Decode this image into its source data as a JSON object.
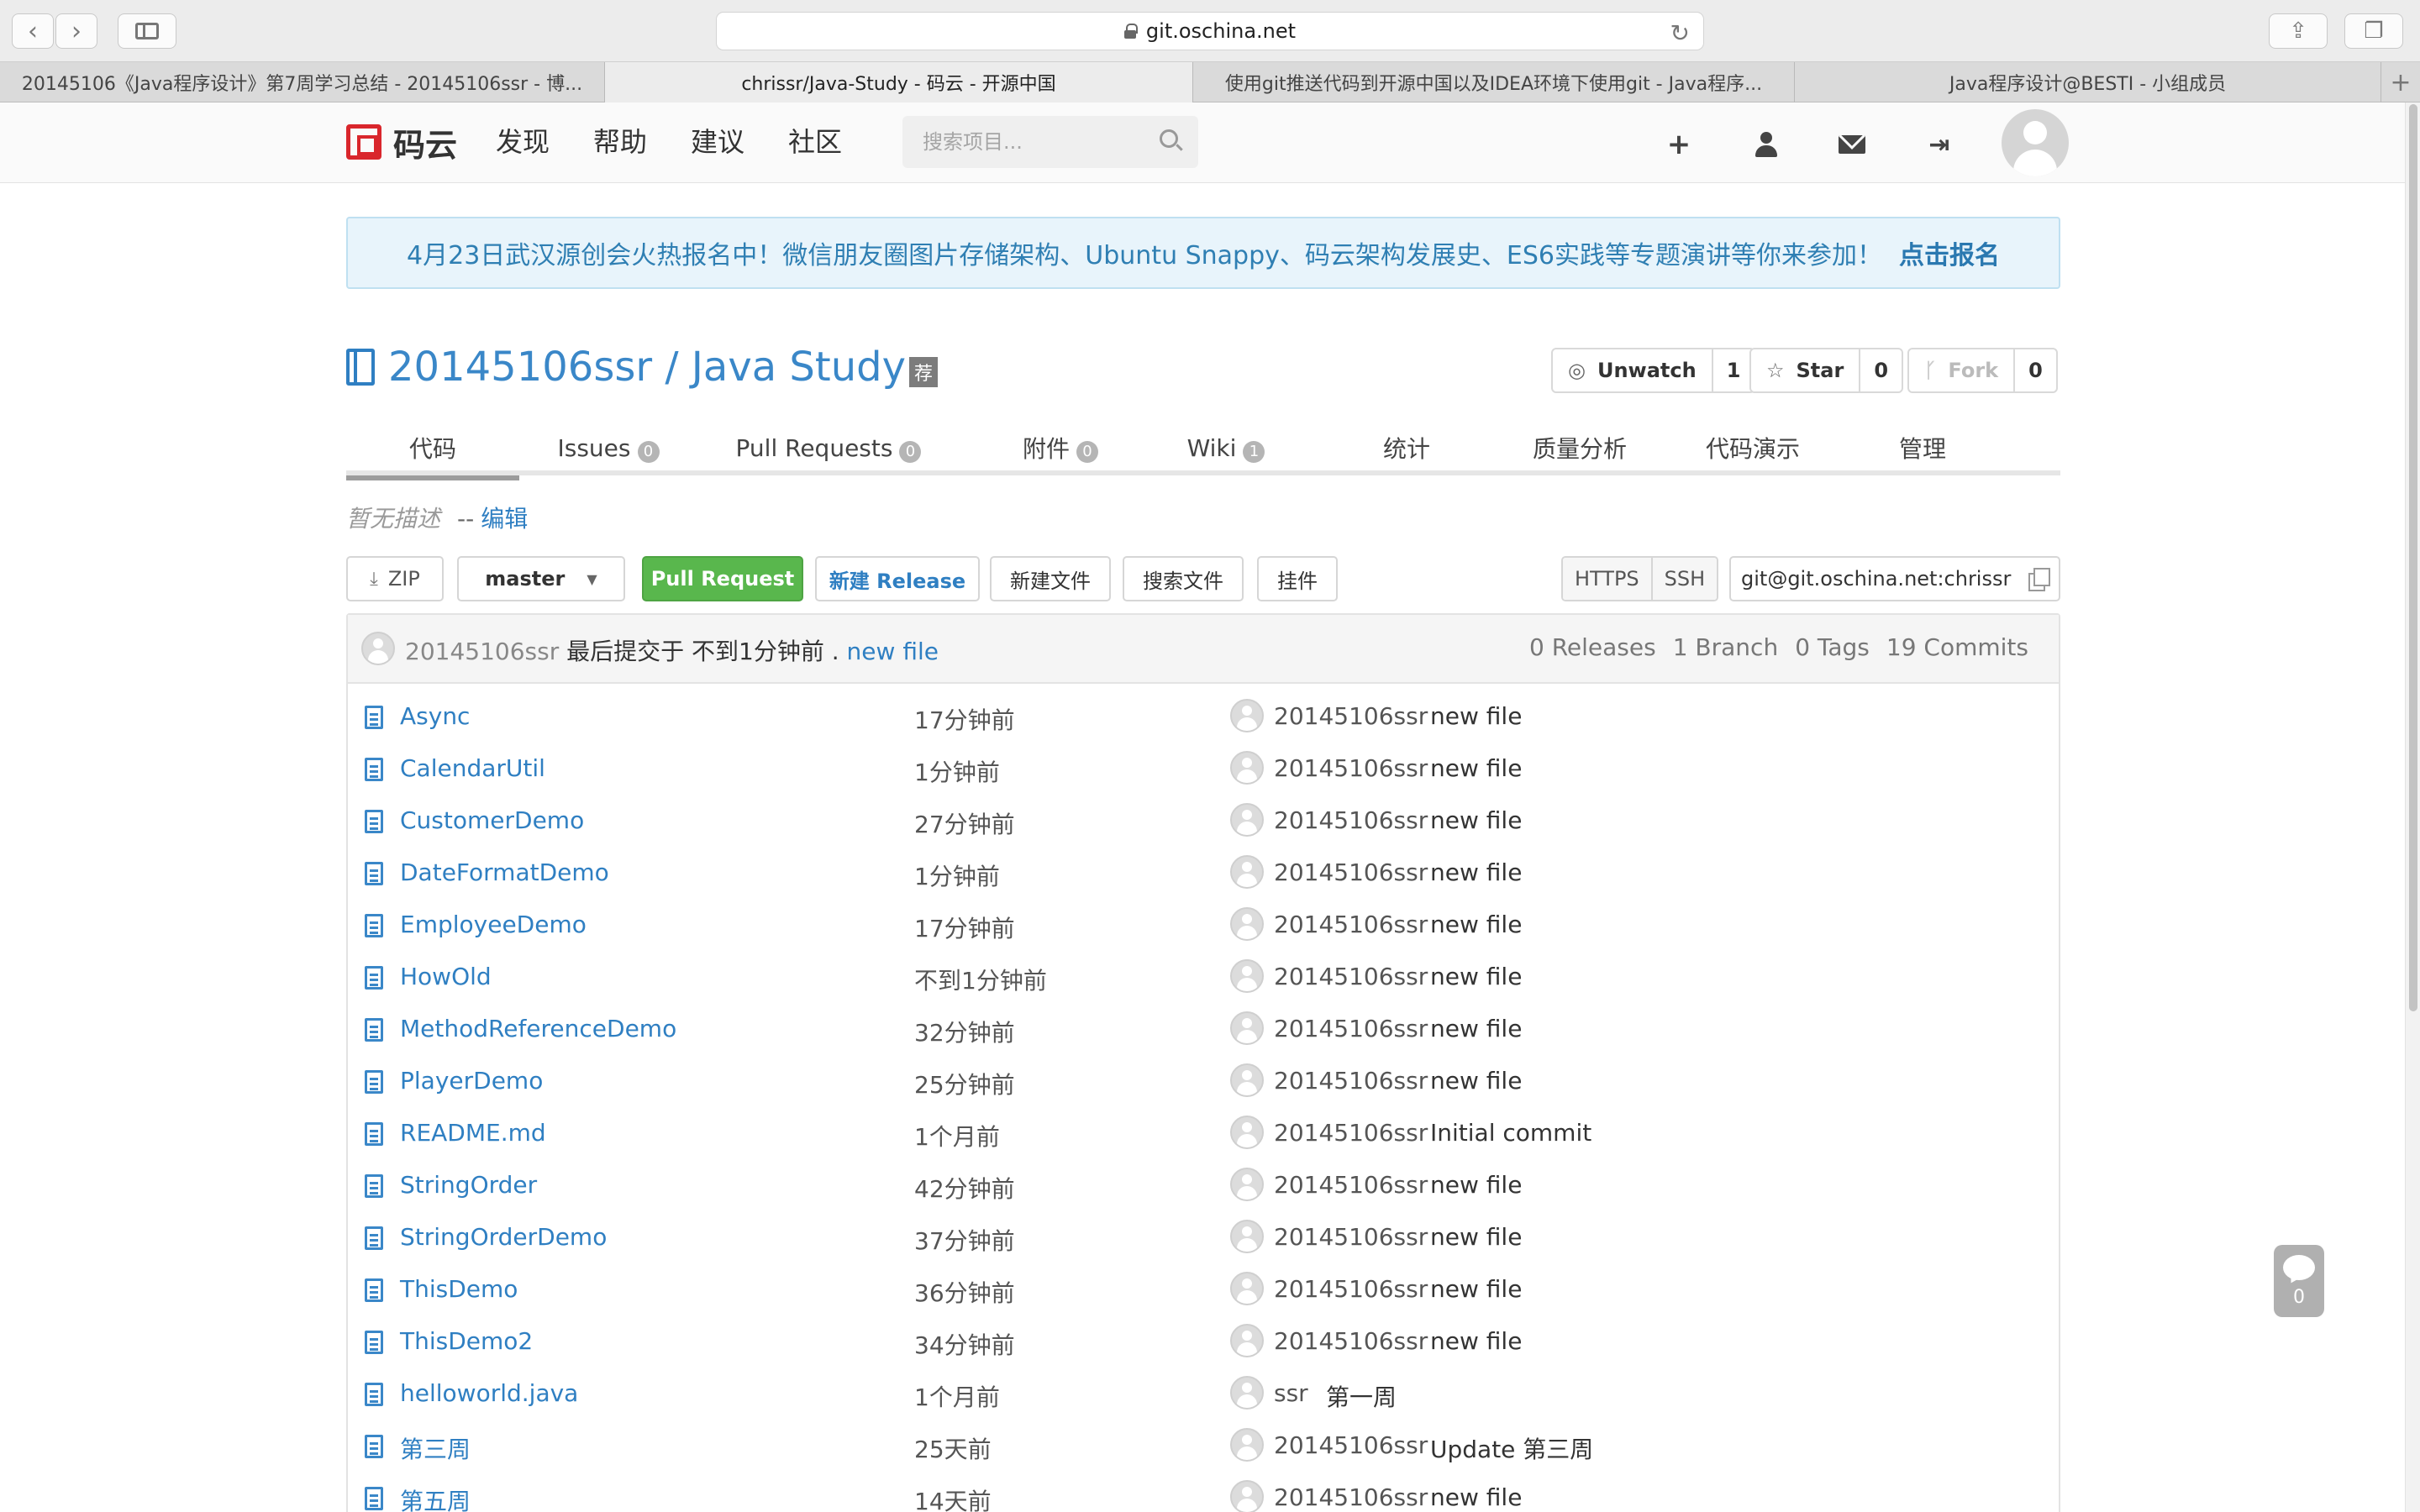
{
  "browser": {
    "address": "git.oschina.net",
    "tabs": [
      {
        "title": "20145106《Java程序设计》第7周学习总结 - 20145106ssr - 博..."
      },
      {
        "title": "chrissr/Java-Study - 码云 - 开源中国"
      },
      {
        "title": "使用git推送代码到开源中国以及IDEA环境下使用git - Java程序..."
      },
      {
        "title": "Java程序设计@BESTI - 小组成员"
      }
    ]
  },
  "header": {
    "logo_text": "码云",
    "nav": [
      "发现",
      "帮助",
      "建议",
      "社区"
    ],
    "search_placeholder": "搜索项目..."
  },
  "notice": {
    "text": "4月23日武汉源创会火热报名中！微信朋友圈图片存储架构、Ubuntu Snappy、码云架构发展史、ES6实践等专题演讲等你来参加！",
    "cta": "点击报名"
  },
  "repo": {
    "title": "20145106ssr / Java Study",
    "badge": "荐",
    "unwatch_label": "Unwatch",
    "watch_count": "1",
    "star_label": "Star",
    "star_count": "0",
    "fork_label": "Fork",
    "fork_count": "0"
  },
  "tabs": [
    {
      "label": "代码",
      "count": ""
    },
    {
      "label": "Issues",
      "count": "0"
    },
    {
      "label": "Pull Requests",
      "count": "0"
    },
    {
      "label": "附件",
      "count": "0"
    },
    {
      "label": "Wiki",
      "count": "1"
    },
    {
      "label": "统计",
      "count": ""
    },
    {
      "label": "质量分析",
      "count": ""
    },
    {
      "label": "代码演示",
      "count": ""
    },
    {
      "label": "管理",
      "count": ""
    }
  ],
  "description": {
    "text": "暂无描述",
    "separator": "--",
    "edit": "编辑"
  },
  "actions": {
    "zip": "ZIP",
    "branch": "master",
    "pull_request": "Pull Request",
    "new_release": "新建 Release",
    "new_file": "新建文件",
    "search_file": "搜索文件",
    "plugins": "挂件",
    "https": "HTTPS",
    "ssh": "SSH",
    "clone_url": "git@git.oschina.net:chrissr"
  },
  "last_commit": {
    "user": "20145106ssr",
    "prefix": "最后提交于 不到1分钟前 .",
    "message": "new file",
    "releases": "0 Releases",
    "branches": "1 Branch",
    "tags": "0 Tags",
    "commits": "19 Commits"
  },
  "files": [
    {
      "name": "Async",
      "time": "17分钟前",
      "user": "20145106ssr",
      "msg": "new file"
    },
    {
      "name": "CalendarUtil",
      "time": "1分钟前",
      "user": "20145106ssr",
      "msg": "new file"
    },
    {
      "name": "CustomerDemo",
      "time": "27分钟前",
      "user": "20145106ssr",
      "msg": "new file"
    },
    {
      "name": "DateFormatDemo",
      "time": "1分钟前",
      "user": "20145106ssr",
      "msg": "new file"
    },
    {
      "name": "EmployeeDemo",
      "time": "17分钟前",
      "user": "20145106ssr",
      "msg": "new file"
    },
    {
      "name": "HowOld",
      "time": "不到1分钟前",
      "user": "20145106ssr",
      "msg": "new file"
    },
    {
      "name": "MethodReferenceDemo",
      "time": "32分钟前",
      "user": "20145106ssr",
      "msg": "new file"
    },
    {
      "name": "PlayerDemo",
      "time": "25分钟前",
      "user": "20145106ssr",
      "msg": "new file"
    },
    {
      "name": "README.md",
      "time": "1个月前",
      "user": "20145106ssr",
      "msg": "Initial commit"
    },
    {
      "name": "StringOrder",
      "time": "42分钟前",
      "user": "20145106ssr",
      "msg": "new file"
    },
    {
      "name": "StringOrderDemo",
      "time": "37分钟前",
      "user": "20145106ssr",
      "msg": "new file"
    },
    {
      "name": "ThisDemo",
      "time": "36分钟前",
      "user": "20145106ssr",
      "msg": "new file"
    },
    {
      "name": "ThisDemo2",
      "time": "34分钟前",
      "user": "20145106ssr",
      "msg": "new file"
    },
    {
      "name": "helloworld.java",
      "time": "1个月前",
      "user": "ssr",
      "msg": "第一周"
    },
    {
      "name": "第三周",
      "time": "25天前",
      "user": "20145106ssr",
      "msg": "Update 第三周"
    },
    {
      "name": "第五周",
      "time": "14天前",
      "user": "20145106ssr",
      "msg": "new file"
    }
  ],
  "chat": {
    "count": "0"
  },
  "colors": {
    "accent": "#2f7fc2",
    "green": "#59b74d",
    "logo_red": "#d9262c"
  },
  "icons": [
    "back-icon",
    "forward-icon",
    "sidebar-icon",
    "lock-icon",
    "reload-icon",
    "share-icon",
    "tabs-icon",
    "plus-icon",
    "user-icon",
    "mail-icon",
    "logout-icon",
    "search-icon",
    "book-icon",
    "file-icon",
    "eye-icon",
    "star-icon",
    "fork-icon",
    "download-icon",
    "copy-icon",
    "chat-icon"
  ]
}
